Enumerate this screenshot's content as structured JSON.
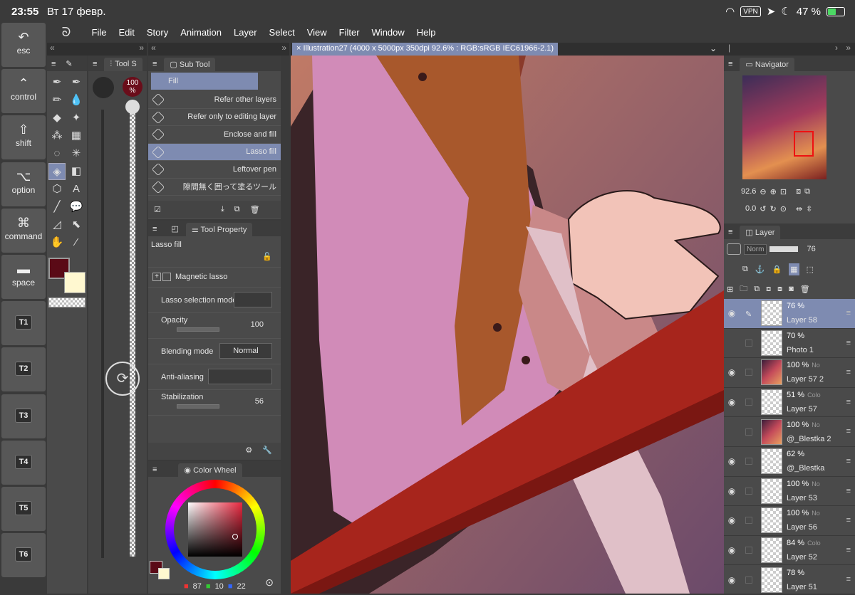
{
  "status": {
    "time": "23:55",
    "date": "Вт 17 февр.",
    "vpn": "VPN",
    "battery": "47 %"
  },
  "modifier_keys": [
    {
      "label": "esc",
      "icon": "undo-icon",
      "glyph": "↶"
    },
    {
      "label": "control",
      "icon": "caret-icon",
      "glyph": "⌃"
    },
    {
      "label": "shift",
      "icon": "shift-icon",
      "glyph": "⇧"
    },
    {
      "label": "option",
      "icon": "option-icon",
      "glyph": "⌥"
    },
    {
      "label": "command",
      "icon": "command-icon",
      "glyph": "⌘"
    },
    {
      "label": "space",
      "icon": "space-icon",
      "glyph": "▬"
    },
    {
      "label": "T1"
    },
    {
      "label": "T2"
    },
    {
      "label": "T3"
    },
    {
      "label": "T4"
    },
    {
      "label": "T5"
    },
    {
      "label": "T6"
    }
  ],
  "menu": [
    "File",
    "Edit",
    "Story",
    "Animation",
    "Layer",
    "Select",
    "View",
    "Filter",
    "Window",
    "Help"
  ],
  "tool_settings": {
    "tab": "Tool S",
    "brush_size": "100 %"
  },
  "sub_tool": {
    "tab": "Sub Tool",
    "group": "Fill",
    "items": [
      "Refer other layers",
      "Refer only to editing layer",
      "Enclose and fill",
      "Lasso fill",
      "Leftover pen",
      "隙間無く囲って塗るツール"
    ]
  },
  "tool_property": {
    "tab": "Tool Property",
    "title": "Lasso fill",
    "magnetic": "Magnetic lasso",
    "selection_mode": "Lasso selection mode",
    "opacity_label": "Opacity",
    "opacity": "100",
    "blending_label": "Blending mode",
    "blending": "Normal",
    "antialias_label": "Anti-aliasing",
    "stabilization_label": "Stabilization",
    "stabilization": "56"
  },
  "color_wheel": {
    "tab": "Color Wheel",
    "r": "87",
    "g": "10",
    "b": "22",
    "main_color": "#5a0a16",
    "sub_color": "#fff8d0"
  },
  "canvas": {
    "title": "Illustration27 (4000 x 5000px 350dpi 92.6% : RGB:sRGB IEC61966-2.1)"
  },
  "navigator": {
    "tab": "Navigator",
    "zoom": "92.6",
    "rotation": "0.0"
  },
  "layer_panel": {
    "tab": "Layer",
    "blend": "Norm",
    "opacity": "76"
  },
  "layers": [
    {
      "pct": "76 %",
      "mode": "",
      "name": "Layer 58",
      "visible": true,
      "selected": true,
      "img": false
    },
    {
      "pct": "70 %",
      "mode": "",
      "name": "Photo 1",
      "visible": false,
      "selected": false,
      "img": false
    },
    {
      "pct": "100 %",
      "mode": "No",
      "name": "Layer 57 2",
      "visible": true,
      "selected": false,
      "img": true
    },
    {
      "pct": "51 %",
      "mode": "Colo",
      "name": "Layer 57",
      "visible": true,
      "selected": false,
      "img": false
    },
    {
      "pct": "100 %",
      "mode": "No",
      "name": "@_Blestka 2",
      "visible": false,
      "selected": false,
      "img": true
    },
    {
      "pct": "62 %",
      "mode": "",
      "name": "@_Blestka",
      "visible": true,
      "selected": false,
      "img": false
    },
    {
      "pct": "100 %",
      "mode": "No",
      "name": "Layer 53",
      "visible": true,
      "selected": false,
      "img": false
    },
    {
      "pct": "100 %",
      "mode": "No",
      "name": "Layer 56",
      "visible": true,
      "selected": false,
      "img": false
    },
    {
      "pct": "84 %",
      "mode": "Colo",
      "name": "Layer 52",
      "visible": true,
      "selected": false,
      "img": false
    },
    {
      "pct": "78 %",
      "mode": "",
      "name": "Layer 51",
      "visible": true,
      "selected": false,
      "img": false
    }
  ]
}
